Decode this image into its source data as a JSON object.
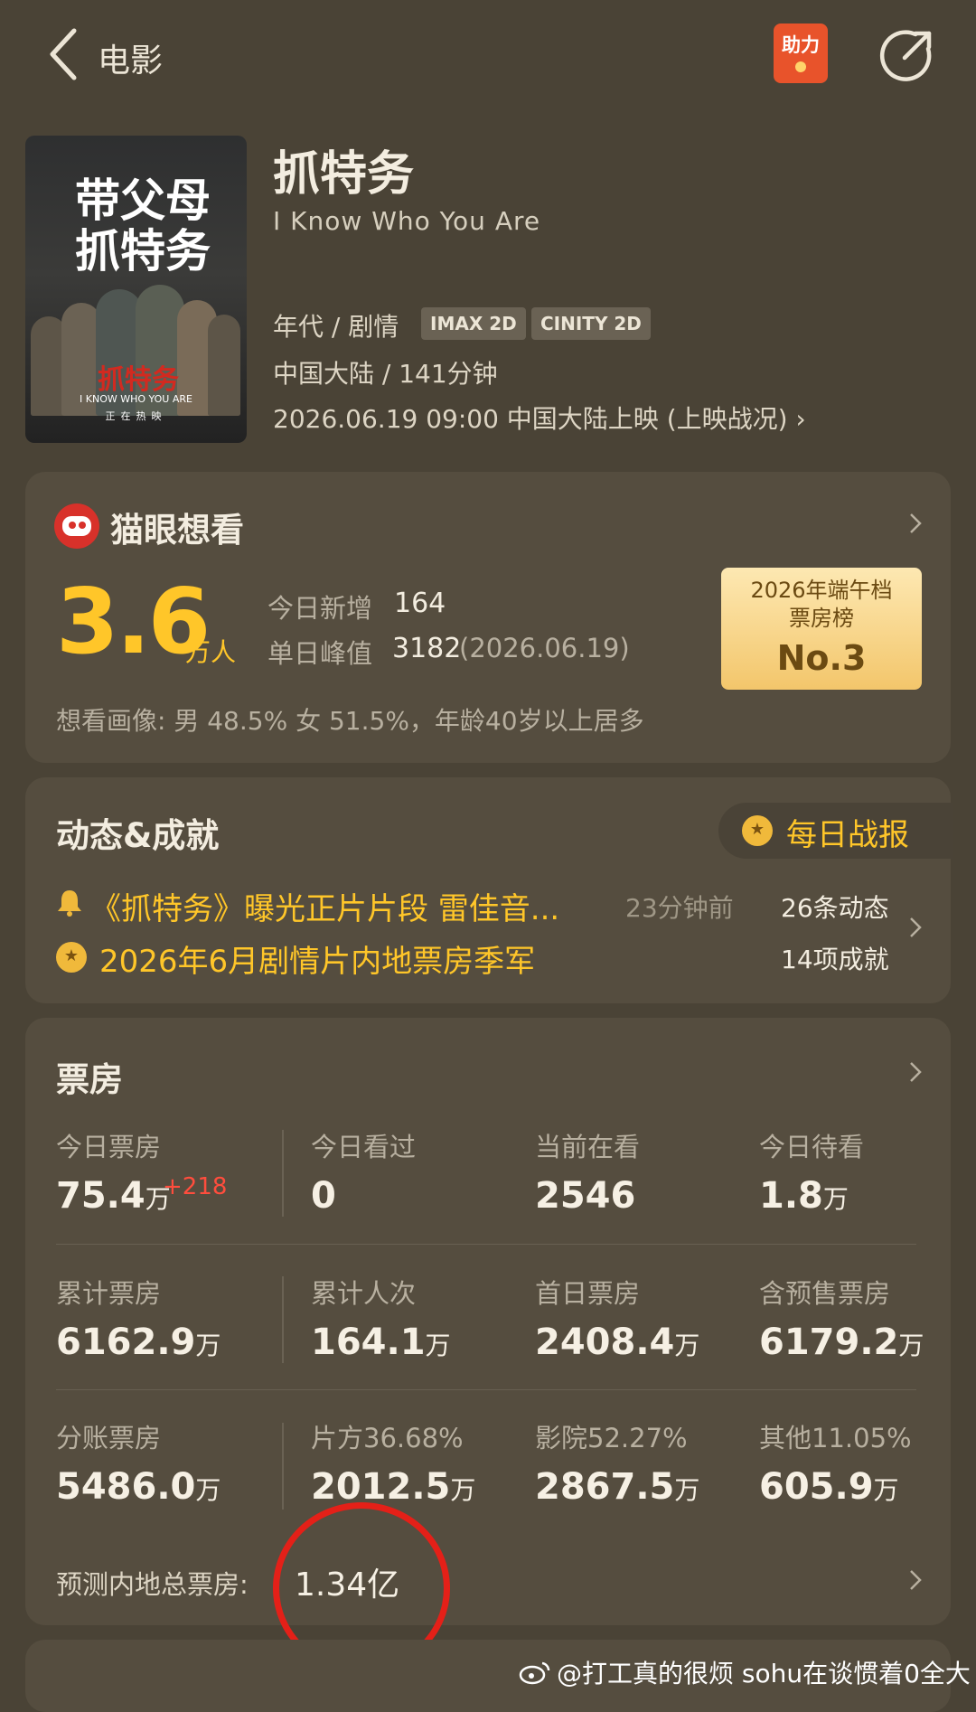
{
  "header": {
    "back_label": "电影",
    "help_badge": "助力"
  },
  "movie": {
    "poster_title": "带父母抓特务",
    "poster_logo": "抓特务",
    "poster_english": "I KNOW WHO YOU ARE",
    "poster_now": "正在热映",
    "title": "抓特务",
    "english_title": "I Know Who You Are",
    "genre": "年代 / 剧情",
    "tags": [
      "IMAX 2D",
      "CINITY 2D"
    ],
    "region_duration": "中国大陆 / 141分钟",
    "release": "2026.06.19 09:00 中国大陆上映 (上映战况)"
  },
  "want_to_see": {
    "title": "猫眼想看",
    "number": "3.6",
    "unit": "万人",
    "today_new_label": "今日新增",
    "today_new_value": "164",
    "peak_label": "单日峰值",
    "peak_value": "3182",
    "peak_date": "(2026.06.19)",
    "rank_line1": "2026年端午档",
    "rank_line2": "票房榜",
    "rank_no": "No.3",
    "portrait": "想看画像: 男 48.5%  女 51.5%，年龄40岁以上居多"
  },
  "dynamics": {
    "title": "动态&成就",
    "daily_report": "每日战报",
    "news": "《抓特务》曝光正片片段 雷佳音...",
    "news_time": "23分钟前",
    "news_count": "26条动态",
    "achievement": "2026年6月剧情片内地票房季军",
    "achievement_count": "14项成就"
  },
  "box_office": {
    "title": "票房",
    "rows": [
      [
        {
          "label": "今日票房",
          "value": "75.4",
          "unit": "万",
          "plus": "+218"
        },
        {
          "label": "今日看过",
          "value": "0",
          "unit": ""
        },
        {
          "label": "当前在看",
          "value": "2546",
          "unit": ""
        },
        {
          "label": "今日待看",
          "value": "1.8",
          "unit": "万"
        }
      ],
      [
        {
          "label": "累计票房",
          "value": "6162.9",
          "unit": "万"
        },
        {
          "label": "累计人次",
          "value": "164.1",
          "unit": "万"
        },
        {
          "label": "首日票房",
          "value": "2408.4",
          "unit": "万"
        },
        {
          "label": "含预售票房",
          "value": "6179.2",
          "unit": "万"
        }
      ],
      [
        {
          "label": "分账票房",
          "value": "5486.0",
          "unit": "万"
        },
        {
          "label": "片方36.68%",
          "value": "2012.5",
          "unit": "万"
        },
        {
          "label": "影院52.27%",
          "value": "2867.5",
          "unit": "万"
        },
        {
          "label": "其他11.05%",
          "value": "605.9",
          "unit": "万"
        }
      ]
    ],
    "forecast_label": "预测内地总票房:",
    "forecast_value": "1.34亿"
  },
  "watermark": "@打工真的很烦  sohu在谈惯着0全大"
}
